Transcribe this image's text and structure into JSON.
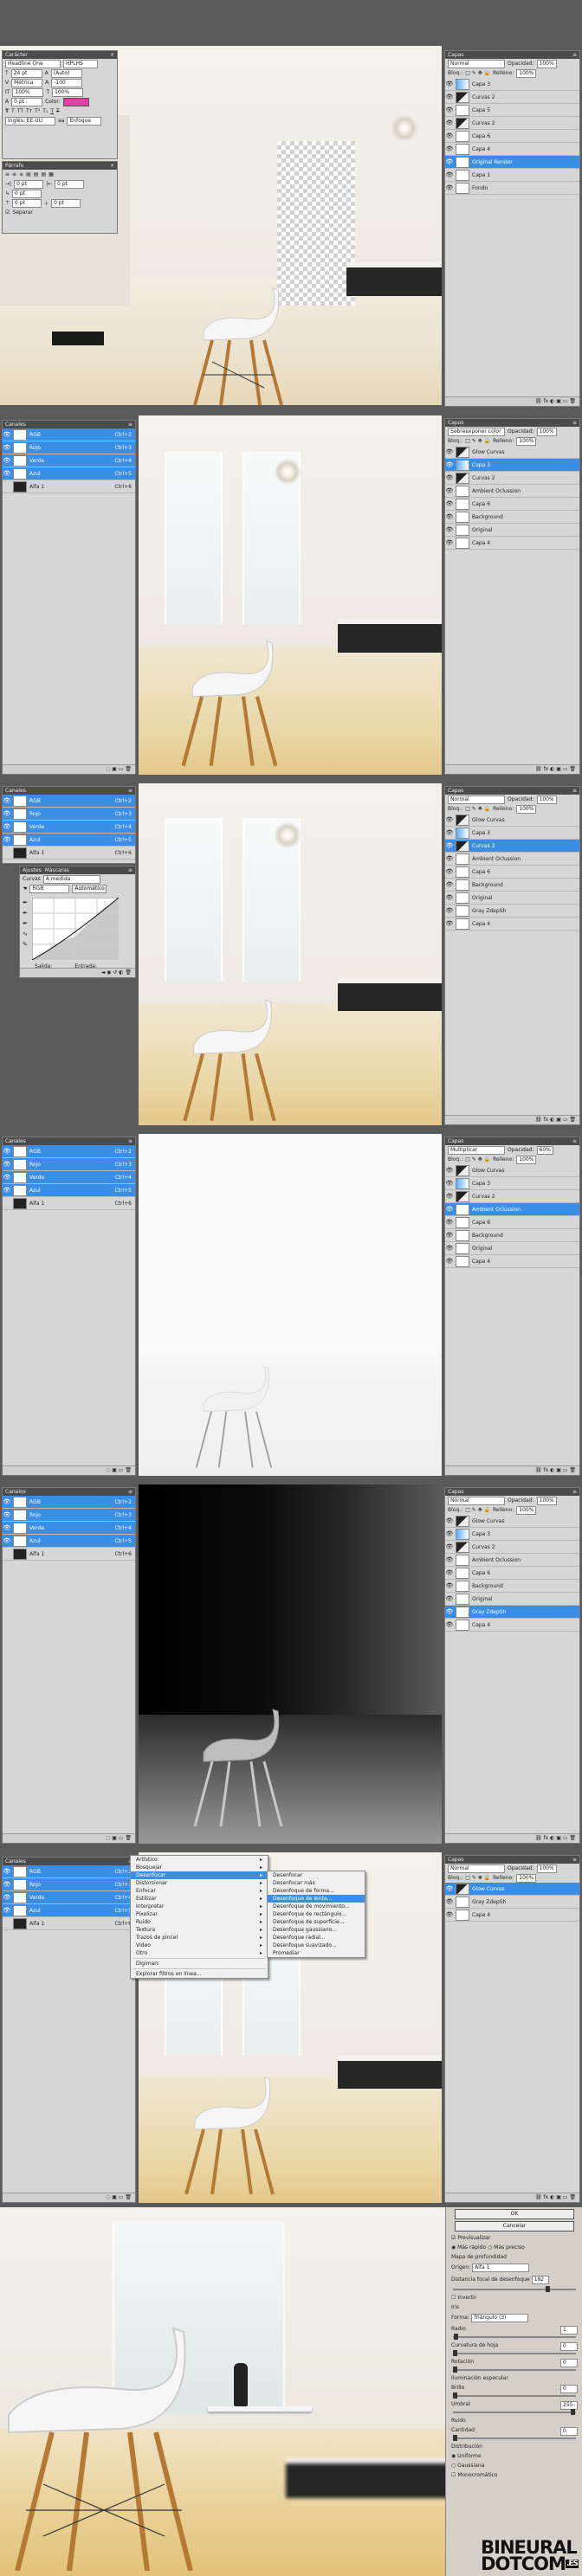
{
  "panels": {
    "caracter": "Carácter",
    "parrafo": "Párrafo",
    "capas": "Capas",
    "canales": "Canales",
    "ajustes": "Ajustes",
    "mascaras": "Máscaras",
    "curvas": "Curvas"
  },
  "character": {
    "font": "Headline One",
    "style": "HPLHS",
    "size": "24 pt",
    "leading": "(Auto)",
    "kerning": "Métrica",
    "tracking": "-100",
    "scale_v": "100%",
    "scale_h": "100%",
    "baseline": "0 pt",
    "color_label": "Color:",
    "color": "#e83ea6",
    "language": "Inglés: EE.UU.",
    "aa": "Enfoque"
  },
  "paragraph": {
    "indent_left": "0 pt",
    "indent_right": "0 pt",
    "first_line": "0 pt",
    "space_before": "0 pt",
    "space_after": "0 pt",
    "hyphenate": "Separar"
  },
  "layers_common": {
    "blend_normal": "Normal",
    "opacity_label": "Opacidad:",
    "opacity": "100%",
    "lock_label": "Bloq.:",
    "fill_label": "Relleno:",
    "fill": "100%"
  },
  "layers1": {
    "items": [
      {
        "name": "Capa 3",
        "sel": false
      },
      {
        "name": "Curvas 2",
        "sel": false
      },
      {
        "name": "Capa 5",
        "sel": false
      },
      {
        "name": "Curvas 2",
        "sel": false
      },
      {
        "name": "Capa 6",
        "sel": false
      },
      {
        "name": "Capa 4",
        "sel": false
      },
      {
        "name": "Original Render",
        "sel": true
      },
      {
        "name": "Capa 1",
        "sel": false
      },
      {
        "name": "Fondo",
        "sel": false
      }
    ]
  },
  "layers2": {
    "blend": "Sobreexponer color",
    "opacity": "100%",
    "items": [
      {
        "name": "Glow Curvas",
        "sel": false
      },
      {
        "name": "Capa 3",
        "sel": true
      },
      {
        "name": "Curvas 2",
        "sel": false
      },
      {
        "name": "Ambient Oclussion",
        "sel": false
      },
      {
        "name": "Capa 6",
        "sel": false
      },
      {
        "name": "Background",
        "sel": false
      },
      {
        "name": "Original",
        "sel": false
      },
      {
        "name": "Capa 4",
        "sel": false
      }
    ]
  },
  "layers3": {
    "items": [
      {
        "name": "Glow Curvas",
        "sel": false
      },
      {
        "name": "Capa 3",
        "sel": false
      },
      {
        "name": "Curvas 2",
        "sel": true
      },
      {
        "name": "Ambient Oclussion",
        "sel": false
      },
      {
        "name": "Capa 6",
        "sel": false
      },
      {
        "name": "Background",
        "sel": false
      },
      {
        "name": "Original",
        "sel": false
      },
      {
        "name": "Gray ZdepSh",
        "sel": false
      },
      {
        "name": "Capa 4",
        "sel": false
      }
    ]
  },
  "layers4": {
    "blend": "Multiplicar",
    "opacity": "60%",
    "items": [
      {
        "name": "Glow Curvas",
        "sel": false
      },
      {
        "name": "Capa 3",
        "sel": false
      },
      {
        "name": "Curvas 2",
        "sel": false
      },
      {
        "name": "Ambient Oclussion",
        "sel": true
      },
      {
        "name": "Capa 6",
        "sel": false
      },
      {
        "name": "Background",
        "sel": false
      },
      {
        "name": "Original",
        "sel": false
      },
      {
        "name": "Capa 4",
        "sel": false
      }
    ]
  },
  "layers5": {
    "items": [
      {
        "name": "Glow Curvas",
        "sel": false
      },
      {
        "name": "Capa 3",
        "sel": false
      },
      {
        "name": "Curvas 2",
        "sel": false
      },
      {
        "name": "Ambient Oclussion",
        "sel": false
      },
      {
        "name": "Capa 6",
        "sel": false
      },
      {
        "name": "Background",
        "sel": false
      },
      {
        "name": "Original",
        "sel": false
      },
      {
        "name": "Gray ZdepSh",
        "sel": true
      },
      {
        "name": "Capa 4",
        "sel": false
      }
    ]
  },
  "layers6": {
    "items": [
      {
        "name": "Glow Curvas",
        "sel": true
      },
      {
        "name": "Gray ZdepSh",
        "sel": false
      },
      {
        "name": "Capa 4",
        "sel": false
      }
    ]
  },
  "channels": {
    "items": [
      {
        "name": "RGB",
        "key": "Ctrl+2"
      },
      {
        "name": "Rojo",
        "key": "Ctrl+3"
      },
      {
        "name": "Verde",
        "key": "Ctrl+4"
      },
      {
        "name": "Azul",
        "key": "Ctrl+5"
      },
      {
        "name": "Alfa 1",
        "key": "Ctrl+6"
      }
    ]
  },
  "curves": {
    "preset": "A medida",
    "channel": "RGB",
    "auto": "Automático",
    "output": "Salida:",
    "input": "Entrada:"
  },
  "filter_menu": {
    "items": [
      "Artístico",
      "Bosquejar",
      "Desenfocar",
      "Distorsionar",
      "Enfocar",
      "Estilizar",
      "Interpretar",
      "Pixelizar",
      "Ruido",
      "Textura",
      "Trazos de pincel",
      "Vídeo",
      "Otro"
    ],
    "selected": "Desenfocar",
    "extra": [
      "Digimarc",
      "Explorar filtros en línea..."
    ],
    "submenu": [
      "Desenfocar",
      "Desenfocar más",
      "Desenfoque de forma...",
      "Desenfoque de lente...",
      "Desenfoque de movimiento...",
      "Desenfoque de rectángulo...",
      "Desenfoque de superficie...",
      "Desenfoque gaussiano...",
      "Desenfoque radial...",
      "Desenfoque suavizado...",
      "Promediar"
    ],
    "sub_selected": "Desenfoque de lente..."
  },
  "lens_blur": {
    "ok": "OK",
    "cancel": "Cancelar",
    "preview": "Previsualizar",
    "faster": "Más rápido",
    "more_accurate": "Más preciso",
    "depth_map": "Mapa de profundidad",
    "source_label": "Origen:",
    "source": "Alfa 1",
    "focal_label": "Distancia focal de desenfoque",
    "focal": "192",
    "invert": "Invertir",
    "iris": "Iris",
    "shape_label": "Forma:",
    "shape": "Triángulo (3)",
    "radius_label": "Radio",
    "radius": "1",
    "curvature_label": "Curvatura de hoja",
    "curvature": "0",
    "rotation_label": "Rotación",
    "rotation": "0",
    "specular": "Iluminación especular",
    "brightness_label": "Brillo",
    "brightness": "0",
    "threshold_label": "Umbral",
    "threshold": "255",
    "noise": "Ruido",
    "amount_label": "Cantidad",
    "amount": "0",
    "distribution": "Distribución",
    "uniform": "Uniforme",
    "gaussian": "Gaussiana",
    "mono": "Monocromático"
  },
  "logo": {
    "line1": "BINEURAL",
    "line2": "DOTCOM",
    "tld": ".ES"
  }
}
